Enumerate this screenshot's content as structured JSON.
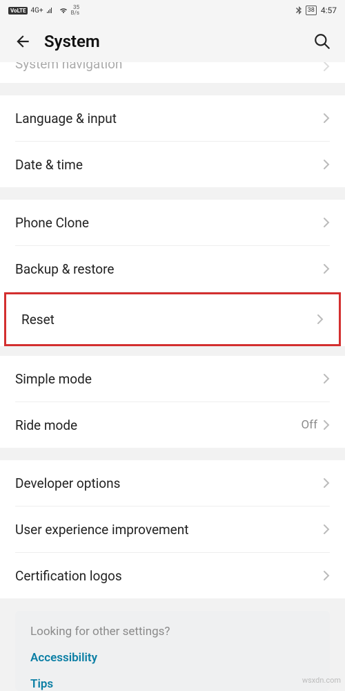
{
  "status": {
    "volte": "VoLTE",
    "network": "4G+",
    "rate_top": "35",
    "rate_bottom": "B/s",
    "battery": "38",
    "time": "4:57"
  },
  "header": {
    "title": "System"
  },
  "cutoff": {
    "label": "System navigation"
  },
  "group1": {
    "language": "Language & input",
    "datetime": "Date & time"
  },
  "group2": {
    "phone_clone": "Phone Clone",
    "backup": "Backup & restore",
    "reset": "Reset"
  },
  "group3": {
    "simple": "Simple mode",
    "ride": "Ride mode",
    "ride_value": "Off"
  },
  "group4": {
    "dev": "Developer options",
    "ux": "User experience improvement",
    "cert": "Certification logos"
  },
  "suggest": {
    "prompt": "Looking for other settings?",
    "accessibility": "Accessibility",
    "tips": "Tips"
  },
  "watermark": "wsxdn.com"
}
